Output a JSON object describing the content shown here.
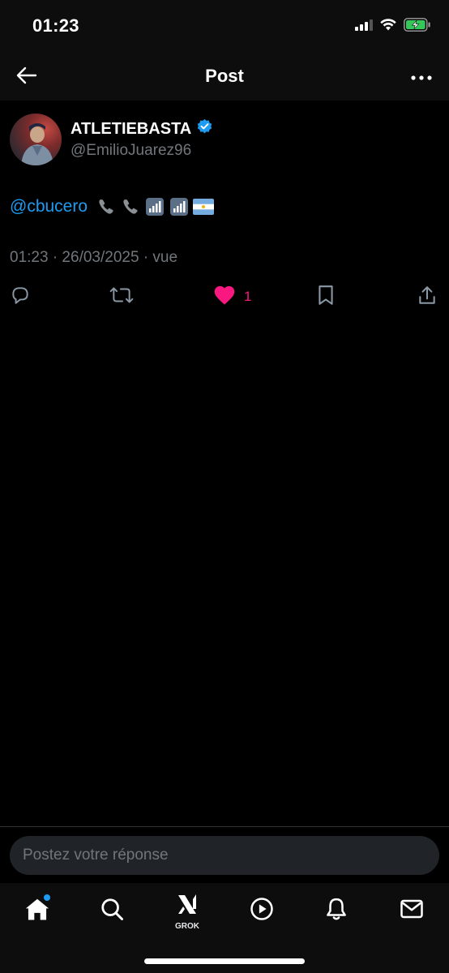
{
  "status_bar": {
    "time": "01:23",
    "icons": [
      "cellular-signal-icon",
      "wifi-icon",
      "battery-charging-icon"
    ],
    "battery_color": "#34c759"
  },
  "header": {
    "title": "Post",
    "back_icon": "arrow-left-icon",
    "more_icon": "more-horizontal-icon"
  },
  "post": {
    "author": {
      "name": "ATLETIEBASTA",
      "handle": "@EmilioJuarez96",
      "verified": true,
      "verified_color": "#1d9bf0"
    },
    "text": {
      "mention": "@cbucero",
      "emojis": [
        "telephone-receiver-emoji",
        "telephone-receiver-emoji",
        "antenna-bars-emoji",
        "antenna-bars-emoji",
        "argentina-flag-emoji"
      ]
    },
    "meta": "01:23 · 26/03/2025 · vue",
    "actions": {
      "reply_icon": "reply-icon",
      "repost_icon": "repost-icon",
      "like_icon": "heart-filled-icon",
      "like_count": "1",
      "like_color": "#f91880",
      "bookmark_icon": "bookmark-icon",
      "share_icon": "share-icon"
    }
  },
  "reply": {
    "placeholder": "Postez votre réponse"
  },
  "tab_bar": {
    "items": [
      {
        "name": "home",
        "icon": "home-icon",
        "active": true,
        "notification_dot": true
      },
      {
        "name": "search",
        "icon": "search-icon"
      },
      {
        "name": "grok",
        "icon": "grok-icon",
        "label": "GROK"
      },
      {
        "name": "video",
        "icon": "play-circle-icon"
      },
      {
        "name": "notifications",
        "icon": "bell-icon"
      },
      {
        "name": "messages",
        "icon": "mail-icon"
      }
    ]
  },
  "colors": {
    "background": "#000000",
    "accent": "#1d9bf0",
    "muted_text": "#71767b",
    "input_bg": "#202327"
  }
}
